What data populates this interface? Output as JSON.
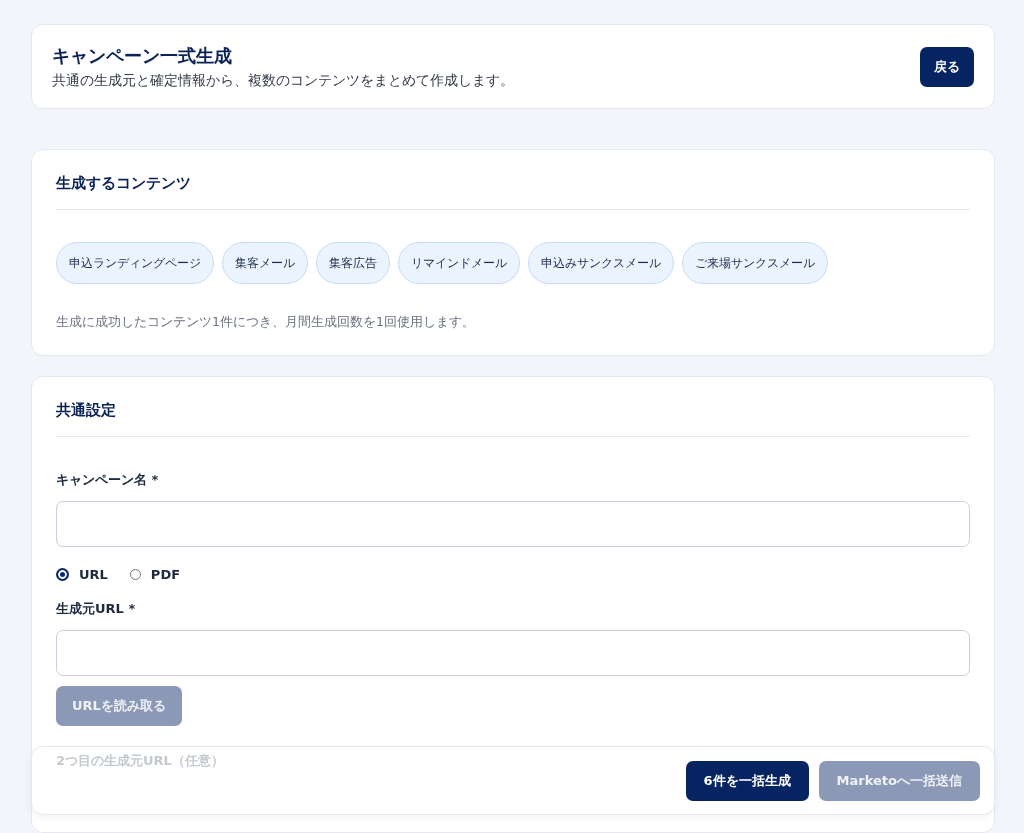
{
  "header": {
    "title": "キャンペーン一式生成",
    "subtitle": "共通の生成元と確定情報から、複数のコンテンツをまとめて作成します。",
    "back_button": "戻る"
  },
  "contents_section": {
    "title": "生成するコンテンツ",
    "chips": [
      {
        "label": "申込ランディングページ",
        "selected": true
      },
      {
        "label": "集客メール",
        "selected": true
      },
      {
        "label": "集客広告",
        "selected": true
      },
      {
        "label": "リマインドメール",
        "selected": true
      },
      {
        "label": "申込みサンクスメール",
        "selected": true
      },
      {
        "label": "ご来場サンクスメール",
        "selected": true
      }
    ],
    "note": "生成に成功したコンテンツ1件につき、月間生成回数を1回使用します。"
  },
  "common_settings": {
    "title": "共通設定",
    "campaign_name_label": "キャンペーン名 *",
    "source_options": [
      {
        "label": "URL",
        "selected": true
      },
      {
        "label": "PDF",
        "selected": false
      }
    ],
    "source_url_label": "生成元URL *",
    "read_url_button": {
      "label": "URLを読み取る",
      "disabled": true
    },
    "second_url_label": "2つ目の生成元URL（任意）"
  },
  "footer": {
    "buttons": [
      {
        "label": "6件を一括生成",
        "disabled": false
      },
      {
        "label": "Marketoへ一括送信",
        "disabled": true
      }
    ]
  }
}
